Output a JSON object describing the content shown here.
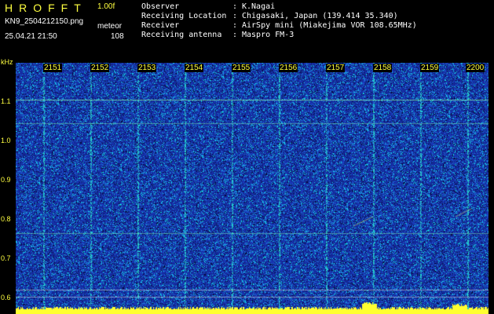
{
  "header": {
    "title": "HROFFT",
    "version": "1.00f",
    "filename": "KN9_2504212150.png",
    "datetime": "25.04.21 21:50",
    "mode_label": "meteor",
    "count": "108"
  },
  "info": [
    {
      "label": "Observer",
      "value": "K.Nagai"
    },
    {
      "label": "Receiving Location",
      "value": "Chigasaki, Japan (139.414 35.340)"
    },
    {
      "label": "Receiver",
      "value": "AirSpy mini (Miakejima VOR 108.65MHz)"
    },
    {
      "label": "Receiving antenna",
      "value": "Maspro FM-3"
    }
  ],
  "axis": {
    "y_unit": "kHz",
    "y_ticks": [
      "1.1",
      "1.0",
      "0.9",
      "0.8",
      "0.7",
      "0.6"
    ],
    "x_ticks": [
      "2151",
      "2152",
      "2153",
      "2154",
      "2155",
      "2156",
      "2157",
      "2158",
      "2159",
      "2200"
    ]
  },
  "colors": {
    "background": "#000000",
    "spectrogram_base": "#1a2aa0",
    "noise_bright": "#00c8e0",
    "label_yellow": "#ffff40"
  }
}
